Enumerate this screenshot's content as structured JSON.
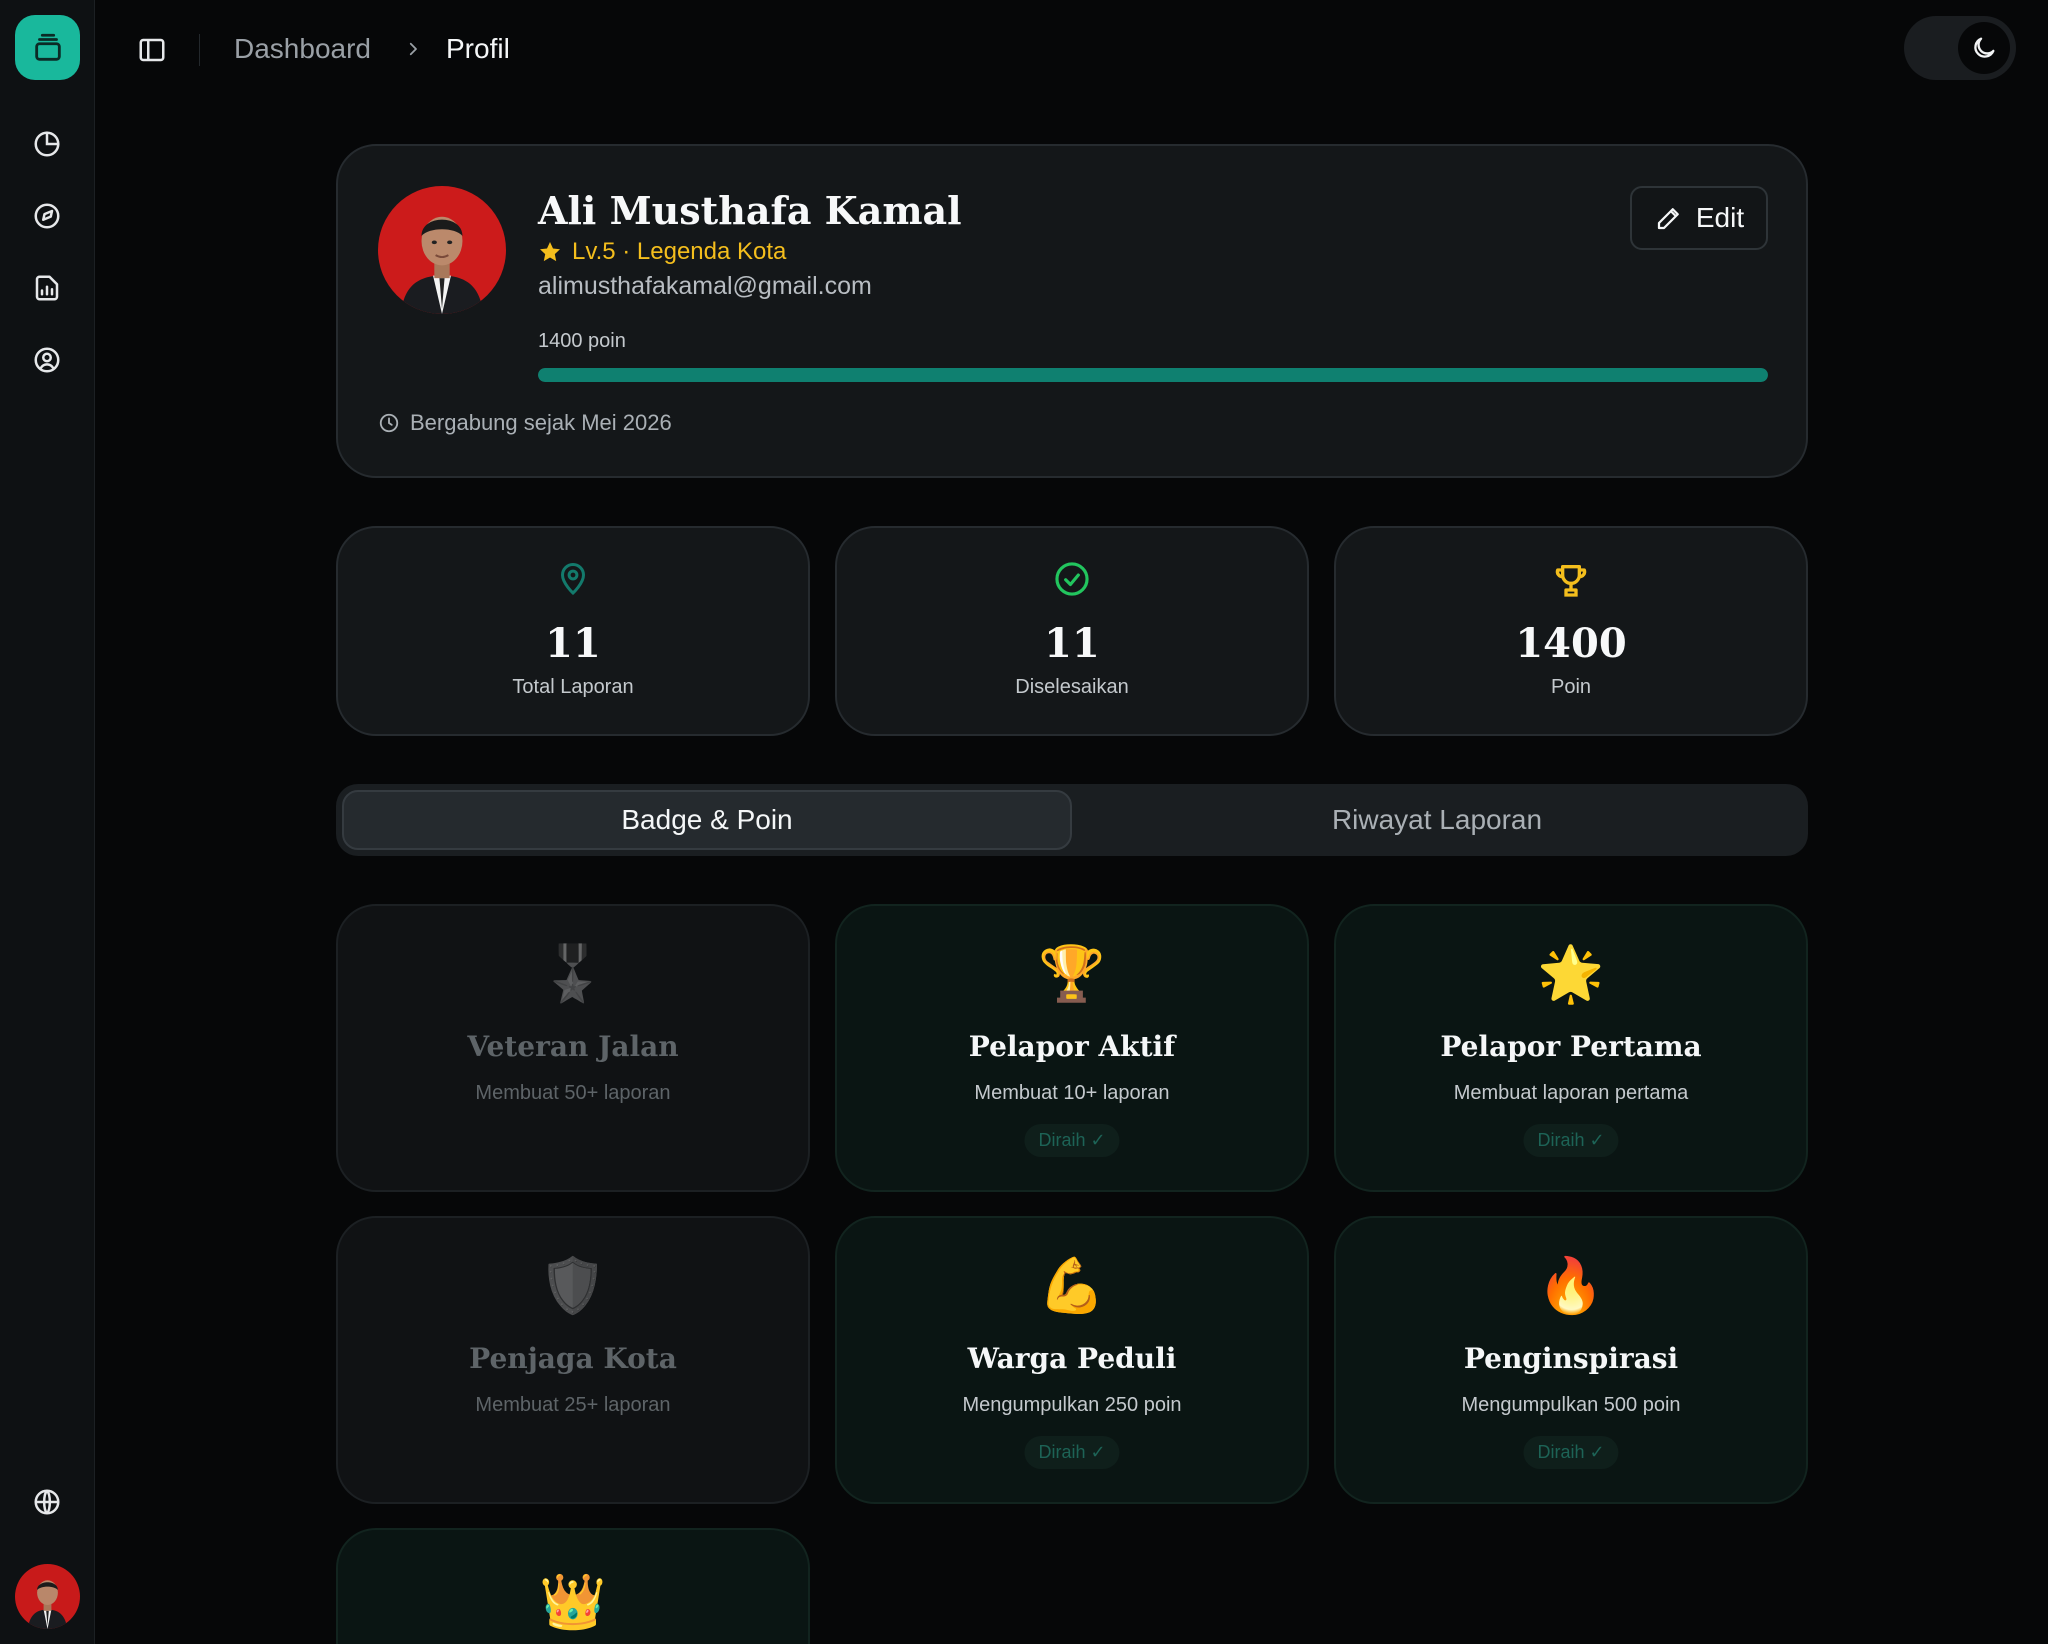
{
  "breadcrumb": {
    "parent": "Dashboard",
    "current": "Profil"
  },
  "profile": {
    "name": "Ali Musthafa Kamal",
    "level": "Lv.5 · Legenda Kota",
    "email": "alimusthafakamal@gmail.com",
    "points_label": "1400 poin",
    "progress": 1.0,
    "joined": "Bergabung sejak Mei 2026",
    "edit_label": "Edit"
  },
  "stats": [
    {
      "value": "11",
      "label": "Total Laporan",
      "icon": "map-pin-icon",
      "color": "#137a6c"
    },
    {
      "value": "11",
      "label": "Diselesaikan",
      "icon": "check-circle-icon",
      "color": "#22c55e"
    },
    {
      "value": "1400",
      "label": "Poin",
      "icon": "trophy-icon",
      "color": "#f4be1d"
    }
  ],
  "tabs": {
    "active": "Badge & Poin",
    "inactive": "Riwayat Laporan"
  },
  "badges": [
    {
      "emoji": "🎖️",
      "title": "Veteran Jalan",
      "desc": "Membuat 50+ laporan",
      "earned": false
    },
    {
      "emoji": "🏆",
      "title": "Pelapor Aktif",
      "desc": "Membuat 10+ laporan",
      "earned": true,
      "status": "Diraih ✓"
    },
    {
      "emoji": "🌟",
      "title": "Pelapor Pertama",
      "desc": "Membuat laporan pertama",
      "earned": true,
      "status": "Diraih ✓"
    },
    {
      "emoji": "🛡️",
      "title": "Penjaga Kota",
      "desc": "Membuat 25+ laporan",
      "earned": false
    },
    {
      "emoji": "💪",
      "title": "Warga Peduli",
      "desc": "Mengumpulkan 250 poin",
      "earned": true,
      "status": "Diraih ✓"
    },
    {
      "emoji": "🔥",
      "title": "Penginspirasi",
      "desc": "Mengumpulkan 500 poin",
      "earned": true,
      "status": "Diraih ✓"
    },
    {
      "emoji": "👑",
      "title": "",
      "desc": "",
      "earned": true
    }
  ],
  "colors": {
    "accent": "#19b89c",
    "progress": "#0f8070",
    "gold": "#f4be1d",
    "success": "#22c55e"
  }
}
